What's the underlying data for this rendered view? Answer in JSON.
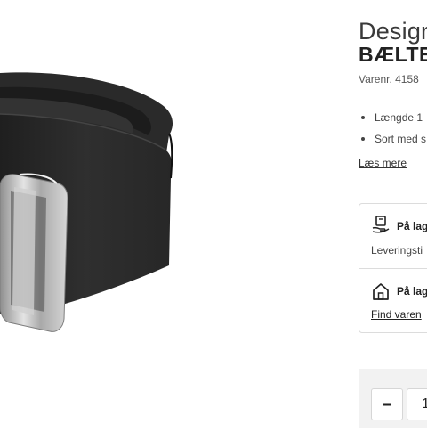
{
  "product": {
    "image_alt": "Sort læderbælte med sølvfarvet spænde",
    "title_line1": "Design",
    "title_line2": "BÆLTE",
    "sku": "Varenr. 4158",
    "bullets": [
      "Længde 1",
      "Sort med s"
    ],
    "read_more": "Læs mere"
  },
  "stock": {
    "online_title": "På lag",
    "online_sub": "Leveringsti",
    "store_title": "På lag",
    "store_link": "Find varen"
  },
  "quantity": {
    "minus_label": "–",
    "value": "1"
  },
  "colors": {
    "belt": "#2e2e2e",
    "buckle": "#b8b8b8",
    "border": "#dcdcdc",
    "qty_bg": "#f2f2f2"
  }
}
